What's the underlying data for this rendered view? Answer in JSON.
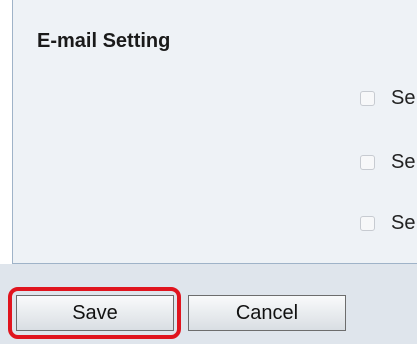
{
  "email_setting": {
    "title": "E-mail Setting",
    "options": [
      {
        "label": "Se",
        "checked": false
      },
      {
        "label": "Se",
        "checked": false
      },
      {
        "label": "Se",
        "checked": false
      }
    ]
  },
  "footer": {
    "save_label": "Save",
    "cancel_label": "Cancel"
  },
  "colors": {
    "highlight": "#e0141e",
    "panel_bg": "#eef2f6",
    "footer_bg": "#dfe5ec"
  }
}
